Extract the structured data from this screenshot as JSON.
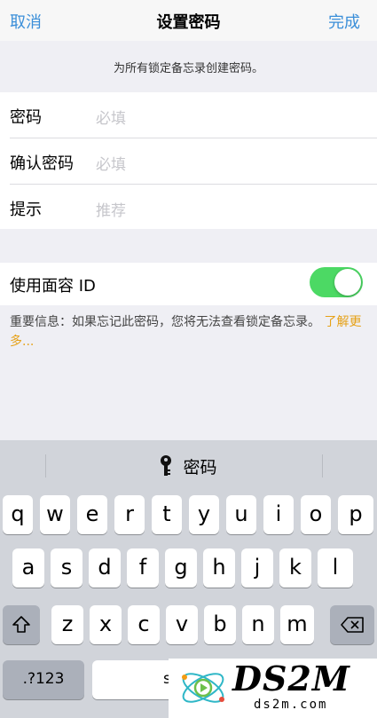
{
  "nav": {
    "cancel": "取消",
    "title": "设置密码",
    "done": "完成"
  },
  "section_header": "为所有锁定备忘录创建密码。",
  "form": {
    "rows": [
      {
        "label": "密码",
        "placeholder": "必填"
      },
      {
        "label": "确认密码",
        "placeholder": "必填"
      },
      {
        "label": "提示",
        "placeholder": "推荐"
      }
    ]
  },
  "faceid": {
    "label": "使用面容 ID",
    "enabled": true
  },
  "info": {
    "text": "重要信息：如果忘记此密码，您将无法查看锁定备忘录。",
    "link": "了解更多..."
  },
  "keyboard": {
    "suggestion": "密码",
    "suggestion_icon": "key-icon",
    "row1": [
      "q",
      "w",
      "e",
      "r",
      "t",
      "y",
      "u",
      "i",
      "o",
      "p"
    ],
    "row2": [
      "a",
      "s",
      "d",
      "f",
      "g",
      "h",
      "j",
      "k",
      "l"
    ],
    "row3": [
      "z",
      "x",
      "c",
      "v",
      "b",
      "n",
      "m"
    ],
    "numbers_key": ".?123",
    "space_key": "s",
    "shift_icon": "shift-icon",
    "delete_icon": "delete-icon"
  },
  "watermark": {
    "brand": "DS2M",
    "domain": "ds2m.com"
  },
  "colors": {
    "accent": "#3b8fd9",
    "toggle_on": "#4cd964",
    "link": "#e6a117"
  }
}
